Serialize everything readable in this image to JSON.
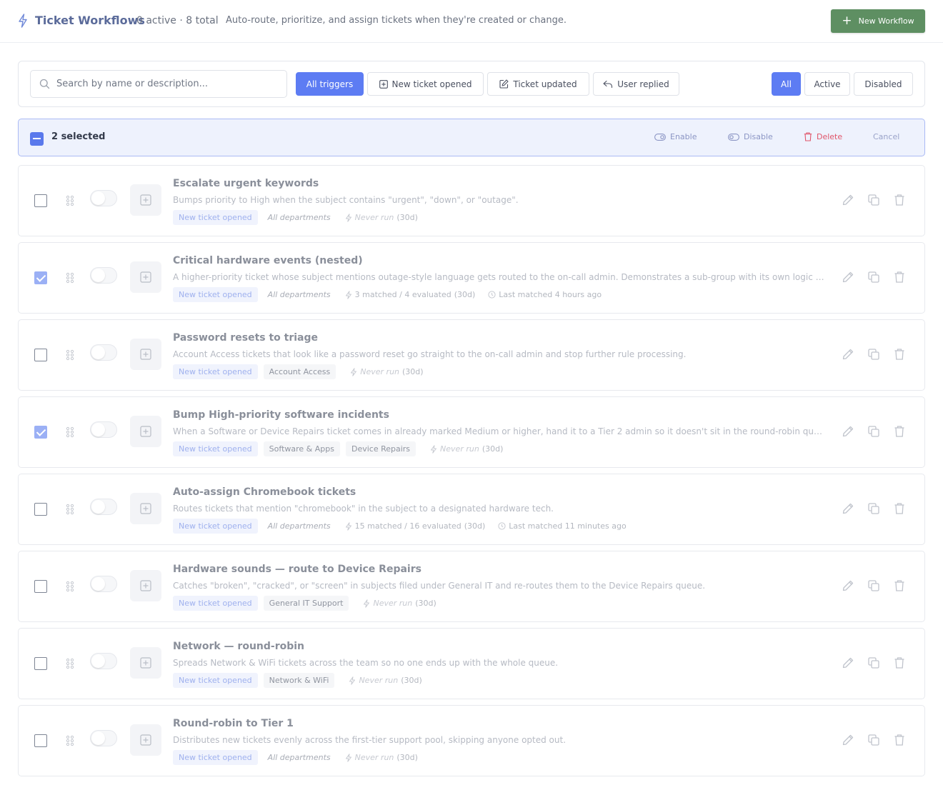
{
  "header": {
    "title": "Ticket Workflows",
    "counts": "0 active · 8 total",
    "subtitle": "Auto-route, prioritize, and assign tickets when they're created or change.",
    "new_button": "New Workflow"
  },
  "filters": {
    "search_placeholder": "Search by name or description...",
    "triggers": [
      "All triggers",
      "New ticket opened",
      "Ticket updated",
      "User replied"
    ],
    "trigger_active": "All triggers",
    "status": [
      "All",
      "Active",
      "Disabled"
    ],
    "status_active": "All"
  },
  "selection": {
    "count_label": "2 selected",
    "enable": "Enable",
    "disable": "Disable",
    "delete": "Delete",
    "cancel": "Cancel"
  },
  "colors": {
    "accent": "#5d7cf3",
    "primary_button": "#5e8f62",
    "danger": "#e0556a"
  },
  "workflows": [
    {
      "title": "Escalate urgent keywords",
      "description": "Bumps priority to High when the subject contains \"urgent\", \"down\", or \"outage\".",
      "trigger": "New ticket opened",
      "scope": "All departments",
      "departments": [],
      "stat_main": "Never run",
      "stat_period": "(30d)",
      "last_matched": "",
      "checked": false,
      "enabled": false
    },
    {
      "title": "Critical hardware events (nested)",
      "description": "A higher-priority ticket whose subject mentions outage-style language gets routed to the on-call admin. Demonstrates a sub-group with its own logic inside the main workflow conditions.",
      "trigger": "New ticket opened",
      "scope": "All departments",
      "departments": [],
      "stat_main": "3 matched / 4 evaluated",
      "stat_period": "(30d)",
      "last_matched": "Last matched 4 hours ago",
      "checked": true,
      "enabled": false
    },
    {
      "title": "Password resets to triage",
      "description": "Account Access tickets that look like a password reset go straight to the on-call admin and stop further rule processing.",
      "trigger": "New ticket opened",
      "scope": "",
      "departments": [
        "Account Access"
      ],
      "stat_main": "Never run",
      "stat_period": "(30d)",
      "last_matched": "",
      "checked": false,
      "enabled": false
    },
    {
      "title": "Bump High-priority software incidents",
      "description": "When a Software or Device Repairs ticket comes in already marked Medium or higher, hand it to a Tier 2 admin so it doesn't sit in the round-robin queue waiting for a free tech.",
      "trigger": "New ticket opened",
      "scope": "",
      "departments": [
        "Software & Apps",
        "Device Repairs"
      ],
      "stat_main": "Never run",
      "stat_period": "(30d)",
      "last_matched": "",
      "checked": true,
      "enabled": false
    },
    {
      "title": "Auto-assign Chromebook tickets",
      "description": "Routes tickets that mention \"chromebook\" in the subject to a designated hardware tech.",
      "trigger": "New ticket opened",
      "scope": "All departments",
      "departments": [],
      "stat_main": "15 matched / 16 evaluated",
      "stat_period": "(30d)",
      "last_matched": "Last matched 11 minutes ago",
      "checked": false,
      "enabled": false
    },
    {
      "title": "Hardware sounds — route to Device Repairs",
      "description": "Catches \"broken\", \"cracked\", or \"screen\" in subjects filed under General IT and re-routes them to the Device Repairs queue.",
      "trigger": "New ticket opened",
      "scope": "",
      "departments": [
        "General IT Support"
      ],
      "stat_main": "Never run",
      "stat_period": "(30d)",
      "last_matched": "",
      "checked": false,
      "enabled": false
    },
    {
      "title": "Network — round-robin",
      "description": "Spreads Network & WiFi tickets across the team so no one ends up with the whole queue.",
      "trigger": "New ticket opened",
      "scope": "",
      "departments": [
        "Network & WiFi"
      ],
      "stat_main": "Never run",
      "stat_period": "(30d)",
      "last_matched": "",
      "checked": false,
      "enabled": false
    },
    {
      "title": "Round-robin to Tier 1",
      "description": "Distributes new tickets evenly across the first-tier support pool, skipping anyone opted out.",
      "trigger": "New ticket opened",
      "scope": "All departments",
      "departments": [],
      "stat_main": "Never run",
      "stat_period": "(30d)",
      "last_matched": "",
      "checked": false,
      "enabled": false
    }
  ]
}
